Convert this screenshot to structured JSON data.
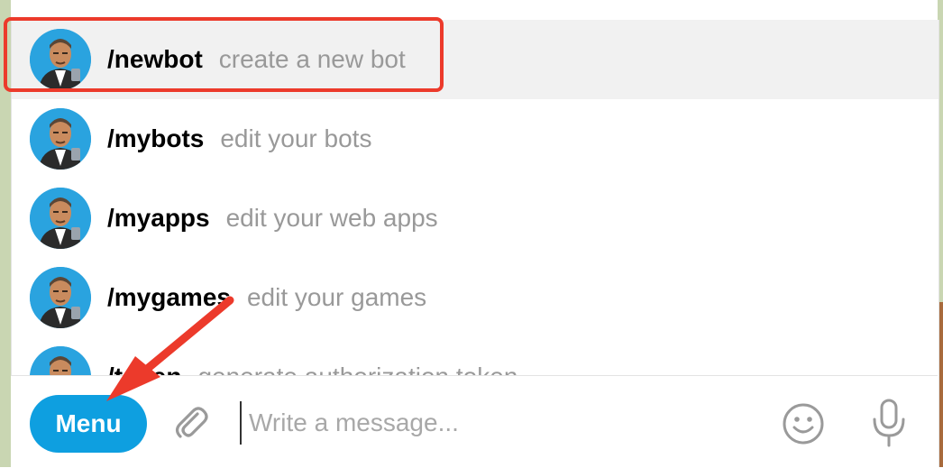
{
  "commands": [
    {
      "name": "/newbot",
      "description": "create a new bot",
      "selected": true
    },
    {
      "name": "/mybots",
      "description": "edit your bots",
      "selected": false
    },
    {
      "name": "/myapps",
      "description": "edit your web apps",
      "selected": false
    },
    {
      "name": "/mygames",
      "description": "edit your games",
      "selected": false
    },
    {
      "name": "/token",
      "description": "generate authorization token",
      "selected": false
    }
  ],
  "compose": {
    "menu_label": "Menu",
    "placeholder": "Write a message..."
  },
  "icons": {
    "attach": "paperclip-icon",
    "emoji": "smiley-icon",
    "mic": "microphone-icon"
  },
  "colors": {
    "accent": "#0e9fe0",
    "annotation": "#ec3a2b",
    "selected_row": "#f1f1f1",
    "description_text": "#999999"
  }
}
